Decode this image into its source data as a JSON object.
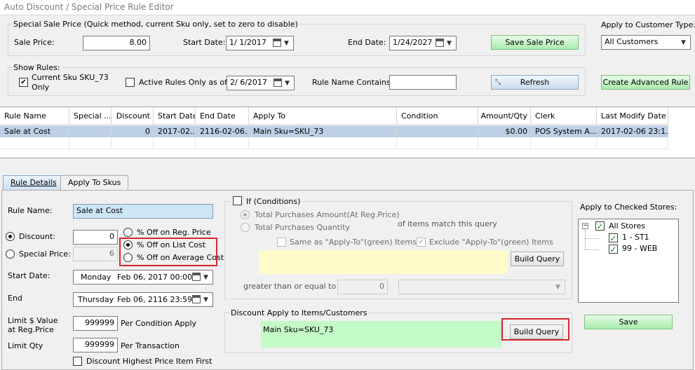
{
  "window": {
    "title": "Auto Discount / Special Price Rule Editor"
  },
  "quick": {
    "legend": "Special Sale Price (Quick method, current Sku only, set to zero to disable)",
    "sale_price_label": "Sale Price:",
    "sale_price_value": "8.00",
    "start_date_label": "Start Date:",
    "start_date_value": "1/ 1/2017",
    "end_date_label": "End Date:",
    "end_date_value": "1/24/2027",
    "save_sale_price_btn": "Save Sale Price"
  },
  "customer_type": {
    "label": "Apply to Customer Type:",
    "value": "All Customers"
  },
  "show_rules": {
    "legend": "Show Rules:",
    "current_sku_label_1": "Current Sku SKU_73",
    "current_sku_label_2": "Only",
    "current_sku_checked": true,
    "active_only_label": "Active Rules Only as of",
    "active_only_checked": false,
    "active_date_value": "2/ 6/2017",
    "rule_name_contains_label": "Rule Name Contains:",
    "rule_name_contains_value": "",
    "refresh_btn": "Refresh"
  },
  "create_advanced_btn": "Create Advanced Rule",
  "grid": {
    "columns": [
      "Rule Name",
      "Special ...",
      "Discount",
      "Start Date",
      "End Date",
      "Apply To",
      "Condition",
      "Amount/Qty",
      "Clerk",
      "Last Modify Date"
    ],
    "rows": [
      [
        "Sale at Cost",
        "",
        "0",
        "2017-02...",
        "2116-02-06...",
        "Main Sku=SKU_73",
        "",
        "$0.00",
        "POS System A...",
        "2017-02-06 23:1..."
      ]
    ]
  },
  "tabs": [
    "Rule Details",
    "Apply To Skus"
  ],
  "details": {
    "rule_name_label": "Rule Name:",
    "rule_name_value": "Sale at Cost",
    "discount_label": "Discount:",
    "discount_value": "0",
    "special_price_label": "Special Price:",
    "special_price_value": "6",
    "discount_selected": "discount",
    "discount_types": [
      "% Off on Reg. Price",
      "% Off on List Cost",
      "% Off on Average Cost"
    ],
    "discount_type_selected": 1,
    "start_date_label": "Start Date:",
    "start_day": "Monday",
    "start_date": "Feb 06, 2017 00:00",
    "end_label": "End",
    "end_day": "Thursday",
    "end_date": "Feb 06, 2116 23:59",
    "limit_value_label_1": "Limit $ Value",
    "limit_value_label_2": "at Reg.Price",
    "limit_value": "999999",
    "per_condition_label": "Per Condition Apply",
    "limit_qty_label": "Limit Qty",
    "limit_qty_value": "999999",
    "per_transaction_label": "Per Transaction",
    "highest_price_label": "Discount Highest Price Item First",
    "highest_price_checked": false
  },
  "conditions": {
    "if_label": "If (Conditions)",
    "if_checked": false,
    "total_amount_label": "Total Purchases Amount(At Reg.Price)",
    "total_qty_label": "Total Purchases Quantity",
    "items_match_label": "of items match this query",
    "same_as_label": "Same  as \"Apply-To\"(green) Items",
    "same_as_checked": false,
    "exclude_label": "Exclude  \"Apply-To\"(green) Items",
    "exclude_checked": true,
    "build_query_btn": "Build Query",
    "gte_label": "greater than or equal to",
    "gte_value": "0"
  },
  "apply_items": {
    "legend": "Discount Apply to Items/Customers",
    "query_text": "Main Sku=SKU_73",
    "build_query_btn": "Build Query"
  },
  "stores": {
    "label": "Apply to Checked Stores:",
    "root": "All Stores",
    "items": [
      "1 - ST1",
      "99 - WEB"
    ]
  },
  "save_btn": "Save",
  "colors": {
    "highlight": "#d6262c",
    "selected_row": "#bdd0e6",
    "green_query": "#c4fac6",
    "yellow_query": "#fffbc8"
  }
}
